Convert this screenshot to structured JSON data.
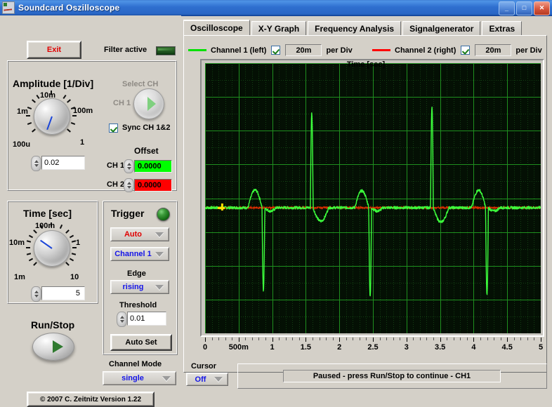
{
  "window": {
    "title": "Soundcard Oszilloscope",
    "icon": "oscilloscope-icon",
    "buttons": {
      "minimize": "_",
      "maximize": "□",
      "close": "✕"
    }
  },
  "left_panel": {
    "exit_label": "Exit",
    "filter_label": "Filter active",
    "filter_led_color": "#1d5e1a",
    "amplitude": {
      "title": "Amplitude [1/Div]",
      "knob_labels": [
        "100u",
        "1m",
        "10m",
        "100m",
        "1"
      ],
      "value": "0.02",
      "select_ch_label": "Select CH",
      "select_ch_value": "CH 1",
      "sync_label": "Sync CH 1&2",
      "sync_checked": true,
      "offset_label": "Offset",
      "ch1_label": "CH 1",
      "ch1_offset": "0.0000",
      "ch1_color": "#00ff00",
      "ch2_label": "CH 2",
      "ch2_offset": "0.0000",
      "ch2_color": "#ff0000"
    },
    "time": {
      "title": "Time [sec]",
      "knob_labels": [
        "1m",
        "10m",
        "100m",
        "1",
        "10"
      ],
      "value": "5"
    },
    "run_stop_label": "Run/Stop",
    "trigger": {
      "title": "Trigger",
      "led_color": "#2f8c2d",
      "mode": "Auto",
      "source": "Channel 1",
      "edge_label": "Edge",
      "edge": "rising",
      "threshold_label": "Threshold",
      "threshold": "0.01",
      "auto_set_label": "Auto Set"
    },
    "channel_mode_label": "Channel Mode",
    "channel_mode": "single",
    "copyright": "© 2007   C. Zeitnitz Version 1.22"
  },
  "tabs": [
    {
      "label": "Oscilloscope",
      "active": true
    },
    {
      "label": "X-Y Graph",
      "active": false
    },
    {
      "label": "Frequency Analysis",
      "active": false
    },
    {
      "label": "Signalgenerator",
      "active": false
    },
    {
      "label": "Extras",
      "active": false
    }
  ],
  "channels": [
    {
      "label": "Channel 1 (left)",
      "color": "#00e000",
      "enabled": true,
      "per_div_value": "20m",
      "per_div_label": "per Div"
    },
    {
      "label": "Channel 2 (right)",
      "color": "#ff0000",
      "enabled": true,
      "per_div_value": "20m",
      "per_div_label": "per Div"
    }
  ],
  "bottom": {
    "cursor_label": "Cursor",
    "cursor_value": "Off",
    "status": "Paused - press Run/Stop to continue - CH1"
  },
  "chart_data": {
    "type": "line",
    "title": "",
    "xlabel": "Time [sec]",
    "ylabel": "",
    "xlim": [
      0,
      5
    ],
    "ylim": [
      -0.16,
      0.16
    ],
    "grid": true,
    "background": "#041004",
    "grid_major_color": "#1f8f1f",
    "grid_minor_color": "#123f12",
    "x_ticks": [
      0,
      0.5,
      1,
      1.5,
      2,
      2.5,
      3,
      3.5,
      4,
      4.5,
      5
    ],
    "x_tick_labels": [
      "0",
      "500m",
      "1",
      "1.5",
      "2",
      "2.5",
      "3",
      "3.5",
      "4",
      "4.5",
      "5"
    ],
    "x_minor_per_major": 5,
    "divisions_x": 10,
    "divisions_y": 16,
    "volts_per_div": 0.02,
    "cursor_marker": {
      "x": 0.25,
      "y": 0.0,
      "color": "#ffe000",
      "shape": "cross"
    },
    "series": [
      {
        "name": "Channel 1 (left)",
        "color": "#3cff3c",
        "baseline": 0.0,
        "beats": [
          {
            "t_spike": 0.86,
            "spike_down": -0.098,
            "bump_up": 0.022,
            "dip": -0.004
          },
          {
            "t_spike": 1.58,
            "spike_up": 0.112,
            "bump_up": 0.0,
            "dip": -0.016
          },
          {
            "t_spike": 2.45,
            "spike_down": -0.106,
            "bump_up": 0.021,
            "dip": -0.004
          },
          {
            "t_spike": 3.37,
            "spike_up": 0.12,
            "bump_up": 0.0,
            "dip": -0.017
          },
          {
            "t_spike": 4.19,
            "spike_down": -0.104,
            "bump_up": 0.022,
            "dip": -0.004
          }
        ],
        "noise_amplitude": 0.002
      },
      {
        "name": "Channel 2 (right)",
        "color": "#ff3300",
        "baseline": 0.0,
        "visible_segments": "sparse-overlay",
        "noise_amplitude": 0.001
      }
    ]
  }
}
